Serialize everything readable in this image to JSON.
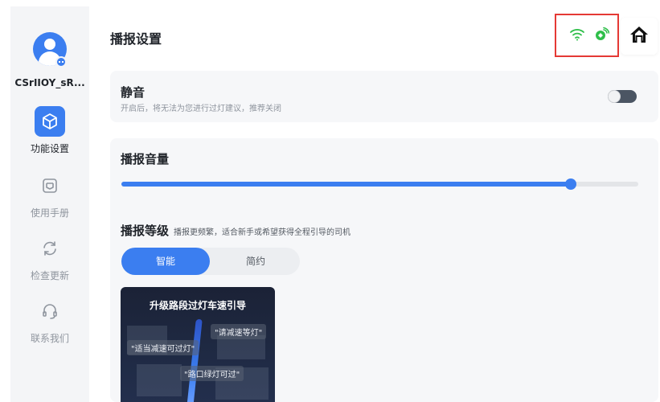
{
  "sidebar": {
    "username": "CSrIIOY_sR...",
    "items": [
      {
        "label": "功能设置",
        "icon": "cube-icon",
        "active": true
      },
      {
        "label": "使用手册",
        "icon": "manual-icon",
        "active": false
      },
      {
        "label": "检查更新",
        "icon": "refresh-icon",
        "active": false
      },
      {
        "label": "联系我们",
        "icon": "headset-icon",
        "active": false
      }
    ]
  },
  "header": {
    "title": "播报设置",
    "status_icons": [
      "wifi-icon",
      "satellite-icon"
    ]
  },
  "mute": {
    "title": "静音",
    "description": "开启后，将无法为您进行过灯建议，推荐关闭",
    "enabled": false
  },
  "volume": {
    "title": "播报音量",
    "value_fraction": 0.87
  },
  "level": {
    "title": "播报等级",
    "description": "播报更频繁，适合新手或希望获得全程引导的司机",
    "options": [
      "智能",
      "简约"
    ],
    "selected": "智能"
  },
  "preview": {
    "title": "升级路段过灯车速引导",
    "bubble_1": "\"请减速等灯\"",
    "bubble_2": "\"适当减速可过灯\"",
    "bubble_3": "\"路口绿灯可过\""
  },
  "colors": {
    "accent": "#3b7ef0",
    "status_green": "#2fbf4a",
    "highlight_border": "#e53935"
  }
}
